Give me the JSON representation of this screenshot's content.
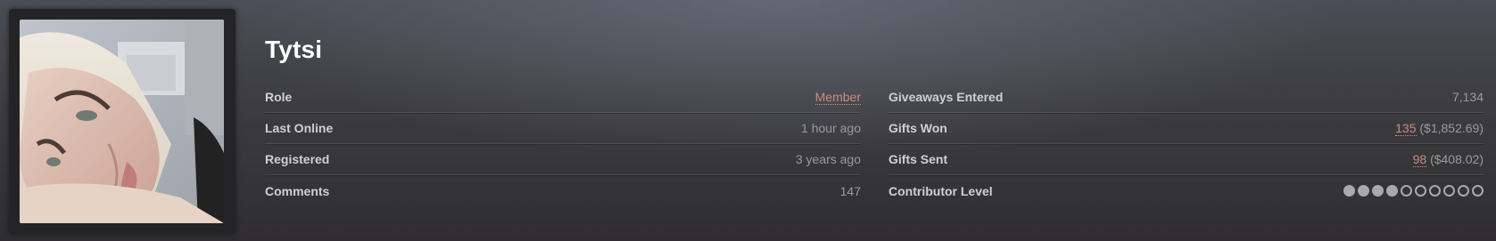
{
  "profile": {
    "username": "Tytsi",
    "avatar_alt": "avatar"
  },
  "stats_left": [
    {
      "label": "Role",
      "value": "Member",
      "link": true
    },
    {
      "label": "Last Online",
      "value": "1 hour ago",
      "link": false
    },
    {
      "label": "Registered",
      "value": "3 years ago",
      "link": false
    },
    {
      "label": "Comments",
      "value": "147",
      "link": false
    }
  ],
  "stats_right": {
    "giveaways_entered": {
      "label": "Giveaways Entered",
      "value": "7,134"
    },
    "gifts_won": {
      "label": "Gifts Won",
      "count": "135",
      "amount": "($1,852.69)"
    },
    "gifts_sent": {
      "label": "Gifts Sent",
      "count": "98",
      "amount": "($408.02)"
    },
    "contributor_level": {
      "label": "Contributor Level",
      "filled": 4,
      "total": 10
    }
  },
  "colors": {
    "link": "#c78d80",
    "label": "#cfd0d4",
    "value": "#9a9a9e",
    "dot": "#a8a8ad"
  }
}
